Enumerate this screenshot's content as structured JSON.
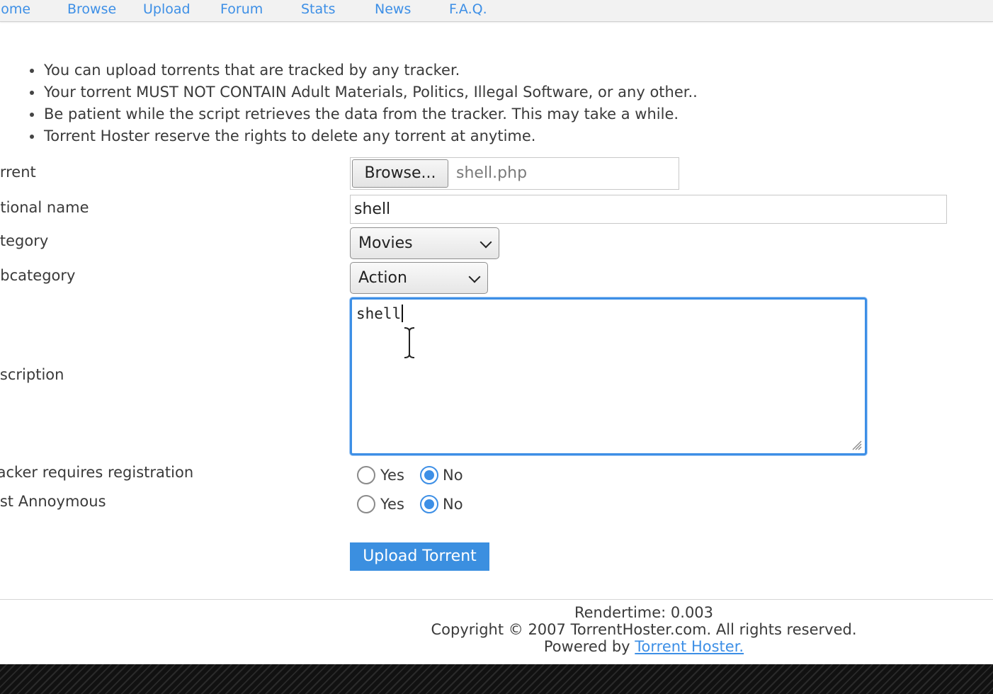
{
  "nav": {
    "items": [
      "Home",
      "Browse",
      "Upload",
      "Forum",
      "Stats",
      "News",
      "F.A.Q."
    ]
  },
  "rules": [
    "You can upload torrents that are tracked by any tracker.",
    "Your torrent MUST NOT CONTAIN Adult Materials, Politics, Illegal Software, or any other..",
    "Be patient while the script retrieves the data from the tracker. This may take a while.",
    "Torrent Hoster reserve the rights to delete any torrent at anytime."
  ],
  "form": {
    "labels": {
      "torrent": "orrent",
      "optional_name": "ptional name",
      "category": "ategory",
      "subcategory": "ubcategory",
      "description": "escription",
      "tracker_registration": "racker requires registration",
      "post_anonymous": "ost Annoymous"
    },
    "file": {
      "button_label": "Browse...",
      "filename": "shell.php"
    },
    "optional_name_value": "shell",
    "category_value": "Movies",
    "subcategory_value": "Action",
    "description_value": "shell",
    "radio": {
      "yes_label": "Yes",
      "no_label": "No",
      "tracker_registration_selected": "No",
      "post_anonymous_selected": "No"
    },
    "submit_label": "Upload Torrent"
  },
  "footer": {
    "rendertime": "Rendertime: 0.003",
    "copyright": "Copyright © 2007 TorrentHoster.com. All rights reserved.",
    "powered_by_prefix": "Powered by ",
    "powered_by_link": "Torrent Hoster."
  },
  "colors": {
    "accent": "#3d8fe6",
    "submit_bg": "#3b8fe0"
  }
}
